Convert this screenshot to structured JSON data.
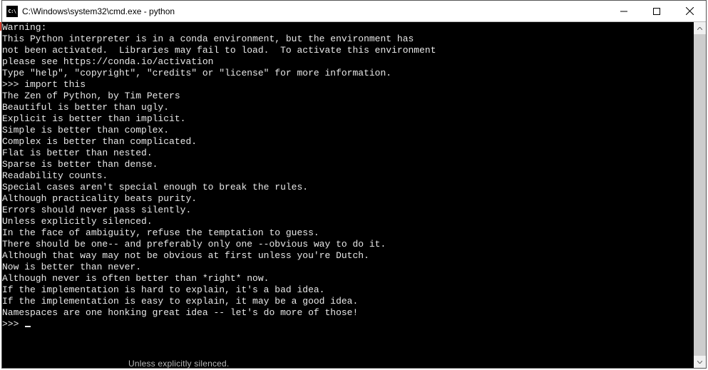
{
  "window": {
    "icon_label": "C:\\",
    "title": "C:\\Windows\\system32\\cmd.exe - python"
  },
  "terminal": {
    "lines": [
      "",
      "Warning:",
      "This Python interpreter is in a conda environment, but the environment has",
      "not been activated.  Libraries may fail to load.  To activate this environment",
      "please see https://conda.io/activation",
      "",
      "Type \"help\", \"copyright\", \"credits\" or \"license\" for more information.",
      ">>> import this",
      "The Zen of Python, by Tim Peters",
      "",
      "Beautiful is better than ugly.",
      "Explicit is better than implicit.",
      "Simple is better than complex.",
      "Complex is better than complicated.",
      "Flat is better than nested.",
      "Sparse is better than dense.",
      "Readability counts.",
      "Special cases aren't special enough to break the rules.",
      "Although practicality beats purity.",
      "Errors should never pass silently.",
      "Unless explicitly silenced.",
      "In the face of ambiguity, refuse the temptation to guess.",
      "There should be one-- and preferably only one --obvious way to do it.",
      "Although that way may not be obvious at first unless you're Dutch.",
      "Now is better than never.",
      "Although never is often better than *right* now.",
      "If the implementation is hard to explain, it's a bad idea.",
      "If the implementation is easy to explain, it may be a good idea.",
      "Namespaces are one honking great idea -- let's do more of those!"
    ],
    "prompt": ">>> "
  },
  "ghost": "Unless explicitly silenced."
}
